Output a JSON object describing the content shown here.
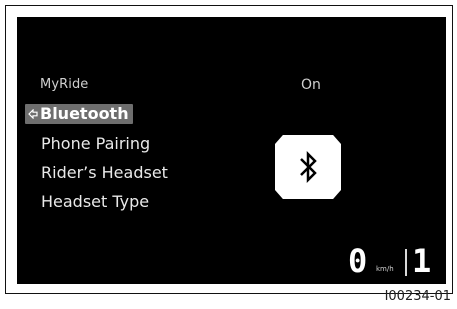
{
  "header": {
    "title": "MyRide",
    "status": "On"
  },
  "menu": {
    "selected_item": "Bluetooth",
    "items": [
      "Phone Pairing",
      "Rider’s Headset",
      "Headset Type"
    ]
  },
  "indicator": {
    "icon": "bluetooth-icon"
  },
  "cluster": {
    "speed": "0",
    "speed_unit": "km/h",
    "gear": "1"
  },
  "caption": "I00234-01",
  "colors": {
    "screen_bg": "#000000",
    "text": "#e9e9e9",
    "selection_bg": "#6e6e6e",
    "icon_bg": "#ffffff"
  }
}
